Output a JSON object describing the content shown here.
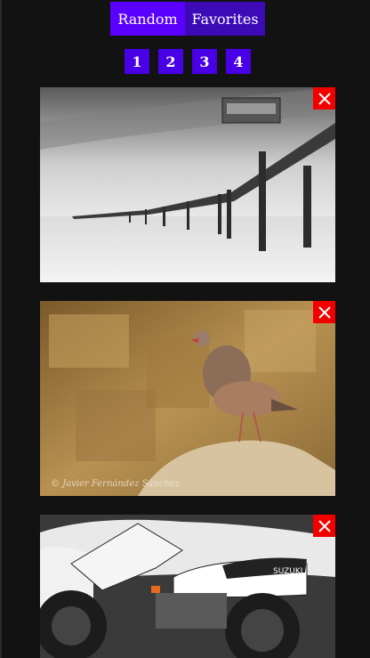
{
  "nav": {
    "tabs": [
      "Random",
      "Favorites"
    ]
  },
  "pager": {
    "pages": [
      "1",
      "2",
      "3",
      "4"
    ]
  },
  "gallery": {
    "items": [
      {
        "subject": "black-and-white long-exposure pier",
        "credit": ""
      },
      {
        "subject": "partridge on rock",
        "credit": "© Javier Fernández Sánchez"
      },
      {
        "subject": "white dirt bike motorcycle",
        "brand": "SUZUKI",
        "credit": ""
      }
    ]
  },
  "colors": {
    "background": "#121212",
    "tab_active": "#5a00ff",
    "tab_inactive": "#3d0ab8",
    "page_button": "#4a00e6",
    "close": "#f20000"
  }
}
